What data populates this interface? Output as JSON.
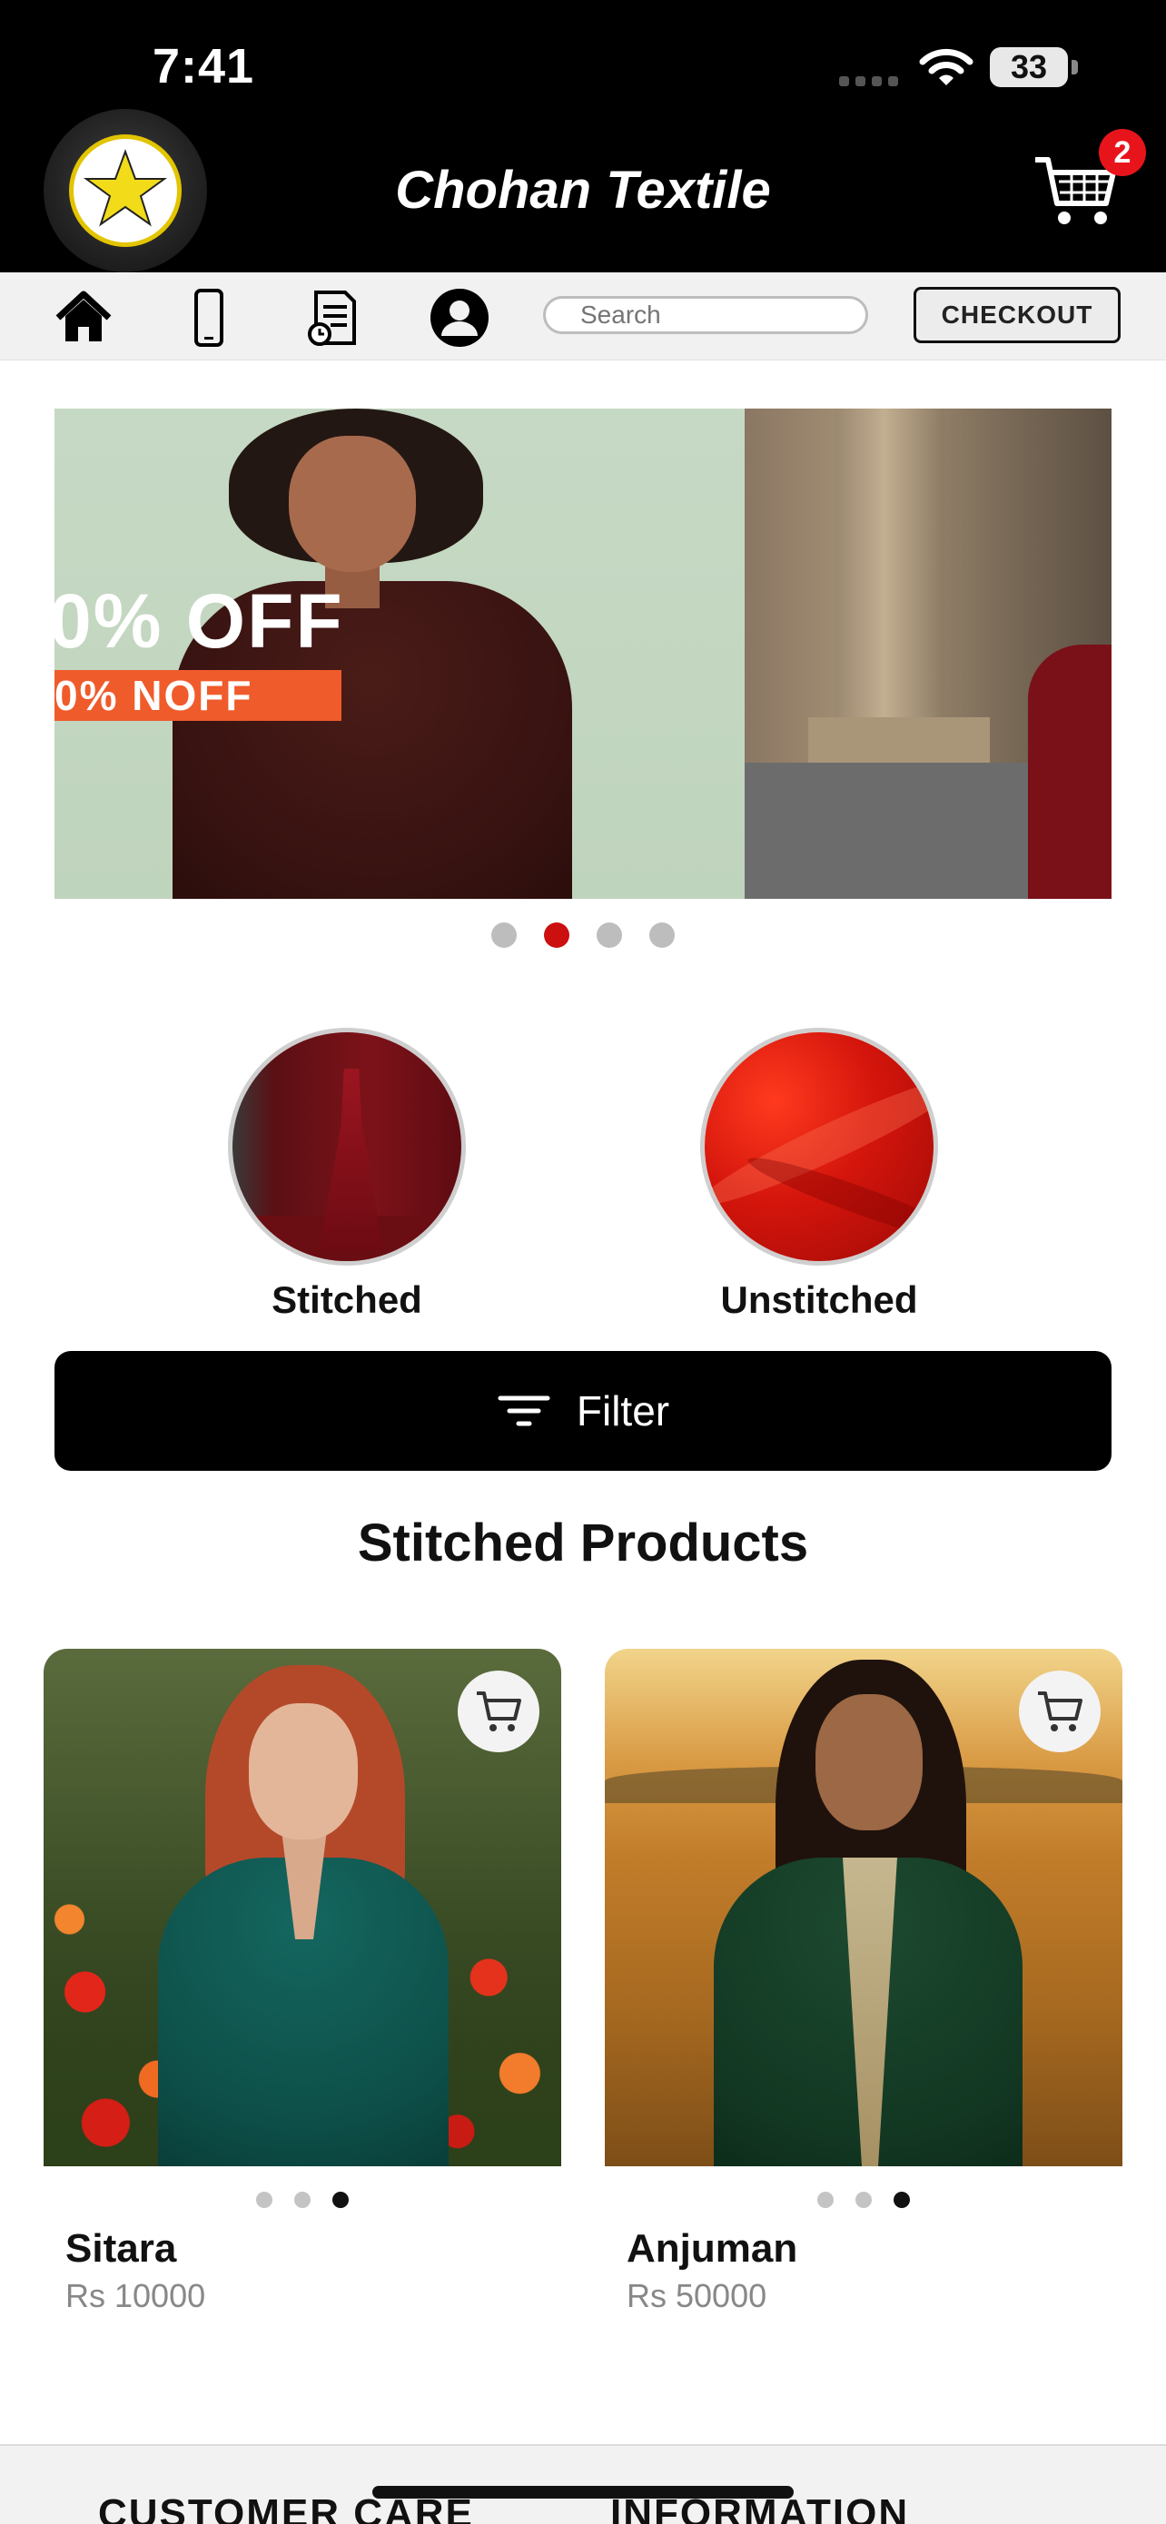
{
  "status_bar": {
    "time": "7:41",
    "battery": "33"
  },
  "header": {
    "title": "Chohan Textile",
    "cart_count": "2"
  },
  "nav": {
    "search_placeholder": "Search",
    "checkout_label": "CHECKOUT",
    "icons": [
      "home-icon",
      "phone-icon",
      "orders-icon",
      "account-icon"
    ]
  },
  "hero": {
    "off_text": "0% OFF",
    "off_tag": "0% NOFF",
    "slide_count": 4,
    "active_slide": 2
  },
  "categories": [
    {
      "label": "Stitched"
    },
    {
      "label": "Unstitched"
    }
  ],
  "filter_label": "Filter",
  "section_title": "Stitched Products",
  "products": [
    {
      "name": "Sitara",
      "price": "Rs 10000",
      "image_count": 3,
      "active_image": 3
    },
    {
      "name": "Anjuman",
      "price": "Rs 50000",
      "image_count": 3,
      "active_image": 3
    }
  ],
  "footer": {
    "col1": "CUSTOMER CARE",
    "col2": "INFORMATION"
  },
  "colors": {
    "accent_red": "#cc0f0f",
    "badge_red": "#e8141c",
    "header_bg": "#000000"
  }
}
